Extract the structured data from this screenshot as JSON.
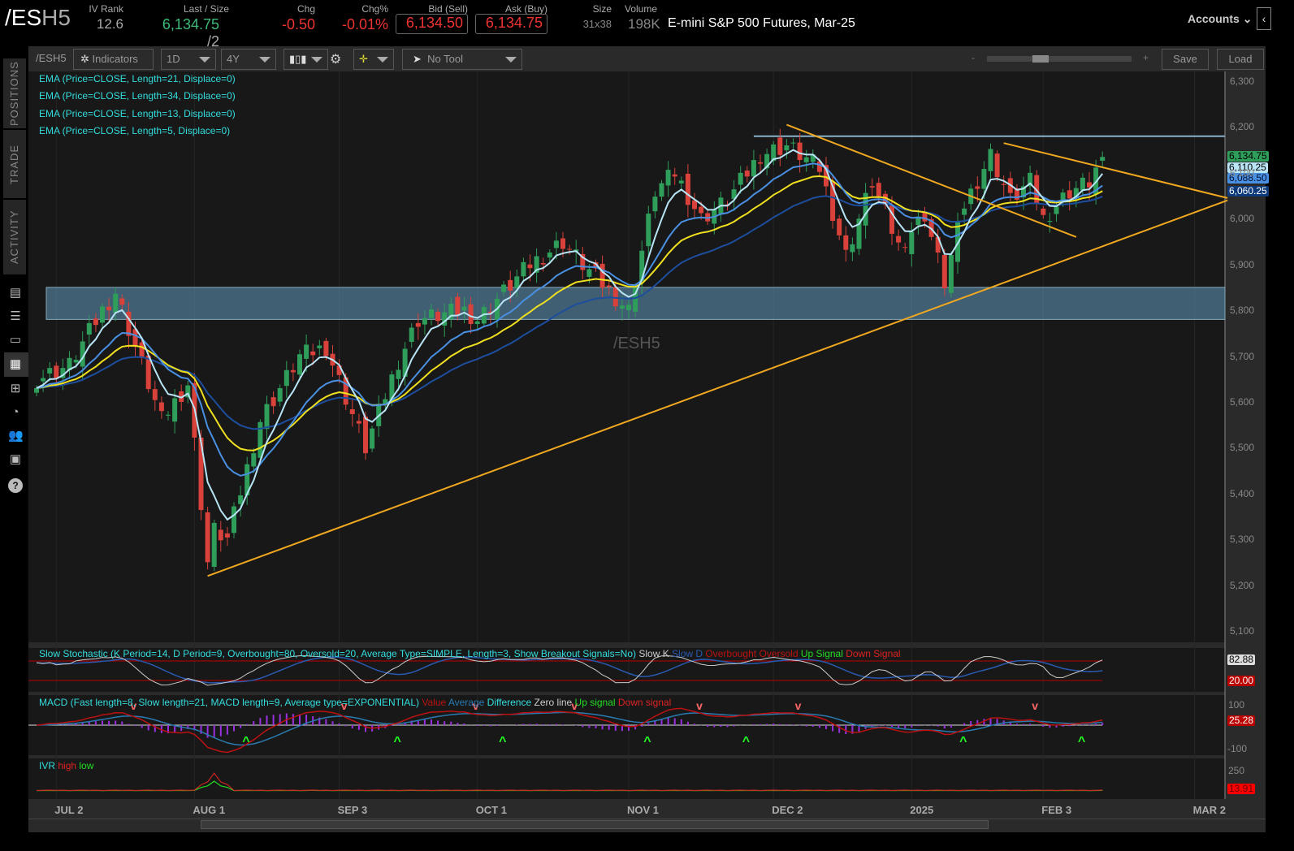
{
  "header": {
    "symbol_main": "/ES",
    "symbol_suffix": "H5",
    "iv_rank_label": "IV Rank",
    "iv_rank": "12.6",
    "last_label": "Last / Size",
    "last": "6,134.75",
    "size": "/2",
    "chg_label": "Chg",
    "chg": "-0.50",
    "chgpct_label": "Chg%",
    "chgpct": "-0.01%",
    "bid_label": "Bid (Sell)",
    "bid": "6,134.50",
    "ask_label": "Ask (Buy)",
    "ask": "6,134.75",
    "sz_label": "Size",
    "sz": "31x38",
    "vol_label": "Volume",
    "vol": "198K",
    "description": "E-mini S&P 500 Futures, Mar-25",
    "accounts": "Accounts"
  },
  "toolbar": {
    "symbol": "/ESH5",
    "indicators": "Indicators",
    "aggregation": "1D",
    "timeframe": "4Y",
    "tool": "No Tool",
    "zoom_minus": "-",
    "zoom_plus": "+",
    "save": "Save",
    "load": "Load"
  },
  "sidebar": {
    "tabs": [
      "POSITIONS",
      "TRADE",
      "ACTIVITY"
    ]
  },
  "studies": {
    "ema": [
      "EMA (Price=CLOSE, Length=21, Displace=0)",
      "EMA (Price=CLOSE, Length=34, Displace=0)",
      "EMA (Price=CLOSE, Length=13, Displace=0)",
      "EMA (Price=CLOSE, Length=5, Displace=0)"
    ],
    "stoch": {
      "title": "Slow Stochastic (K Period=14, D Period=9, Overbought=80, Oversold=20, Average Type=SIMPLE, Length=3, Show Breakout Signals=No)",
      "legend": [
        "Slow K",
        "Slow D",
        "Overbought",
        "Oversold",
        "Up Signal",
        "Down Signal"
      ],
      "value": "82.88",
      "oversold": "20.00"
    },
    "macd": {
      "title": "MACD (Fast length=8, Slow length=21, MACD length=9, Average type=EXPONENTIAL)",
      "legend": [
        "Value",
        "Average",
        "Difference",
        "Zero line",
        "Up signal",
        "Down signal"
      ],
      "tick_top": "100",
      "tick_bottom": "-100",
      "value": "25.28"
    },
    "ivr": {
      "title": "IVR",
      "legend": [
        "high",
        "low"
      ],
      "tick": "250",
      "value": "13.91"
    }
  },
  "watermark": "/ESH5",
  "price_tags": {
    "last": "6,134.75",
    "ema5": "6,110.25",
    "ema13": "6,088.50",
    "ema34": "6,060.25"
  },
  "colors": {
    "up": "#2e9e5a",
    "down": "#d9423a",
    "ema5": "#b8e4f5",
    "ema13": "#4a90e2",
    "ema21": "#f0e020",
    "ema34": "#1d4e9e",
    "trend": "#f0a820",
    "zone": "#5b8fb0"
  },
  "chart_data": {
    "type": "candlestick",
    "price_ticks": [
      6300,
      6200,
      6100,
      6000,
      5900,
      5800,
      5700,
      5600,
      5500,
      5400,
      5300,
      5200,
      5100
    ],
    "x_ticks": [
      {
        "label": "JUL 2",
        "day": 3
      },
      {
        "label": "AUG 1",
        "day": 24
      },
      {
        "label": "SEP 3",
        "day": 46
      },
      {
        "label": "OCT 1",
        "day": 67
      },
      {
        "label": "NOV 1",
        "day": 90
      },
      {
        "label": "DEC 2",
        "day": 112
      },
      {
        "label": "2025",
        "day": 133
      },
      {
        "label": "FEB 3",
        "day": 153
      },
      {
        "label": "MAR 2",
        "day": 176
      }
    ],
    "close_path": [
      [
        0,
        5650
      ],
      [
        5,
        5680
      ],
      [
        10,
        5800
      ],
      [
        12,
        5840
      ],
      [
        15,
        5720
      ],
      [
        19,
        5560
      ],
      [
        23,
        5640
      ],
      [
        26,
        5250
      ],
      [
        27,
        5320
      ],
      [
        29,
        5300
      ],
      [
        34,
        5560
      ],
      [
        40,
        5700
      ],
      [
        44,
        5720
      ],
      [
        50,
        5500
      ],
      [
        55,
        5690
      ],
      [
        58,
        5780
      ],
      [
        65,
        5800
      ],
      [
        67,
        5780
      ],
      [
        75,
        5900
      ],
      [
        80,
        5950
      ],
      [
        83,
        5900
      ],
      [
        90,
        5800
      ],
      [
        94,
        6060
      ],
      [
        97,
        6100
      ],
      [
        101,
        6000
      ],
      [
        105,
        6040
      ],
      [
        110,
        6140
      ],
      [
        114,
        6160
      ],
      [
        119,
        6110
      ],
      [
        123,
        5920
      ],
      [
        125,
        6000
      ],
      [
        127,
        6080
      ],
      [
        131,
        5940
      ],
      [
        135,
        6010
      ],
      [
        138,
        5860
      ],
      [
        141,
        6030
      ],
      [
        145,
        6140
      ],
      [
        148,
        6040
      ],
      [
        151,
        6080
      ],
      [
        153,
        6000
      ],
      [
        157,
        6060
      ],
      [
        160,
        6080
      ],
      [
        162,
        6134.75
      ]
    ],
    "support_zone": [
      5780,
      5850
    ],
    "resistance_line": {
      "price": 6180,
      "from_day": 109
    },
    "trendlines": [
      {
        "from": [
          26,
          5220
        ],
        "to": [
          181,
          6040
        ]
      },
      {
        "from": [
          114,
          6205
        ],
        "to": [
          158,
          5960
        ]
      },
      {
        "from": [
          147,
          6165
        ],
        "to": [
          181,
          6045
        ]
      }
    ],
    "ema_lengths": [
      5,
      13,
      21,
      34
    ]
  }
}
